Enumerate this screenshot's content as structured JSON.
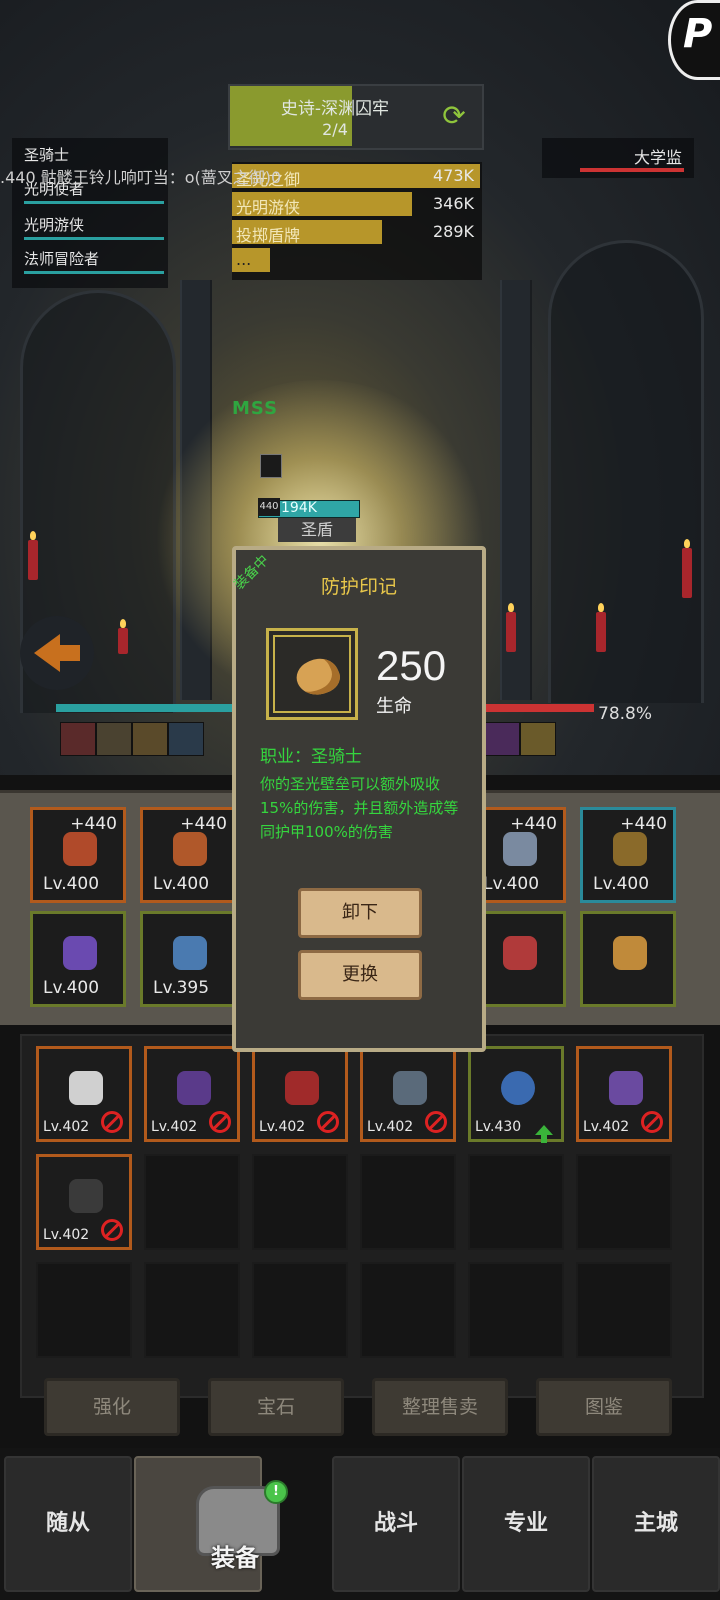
{
  "stage": {
    "title": "史诗-深渊囚牢",
    "progress": "2/4",
    "fill_fraction": 0.5
  },
  "party": [
    "圣骑士",
    "光明使者",
    "光明游侠",
    "法师冒险者"
  ],
  "chat": ".440 骷髅王铃儿响叮当：o(蔷叉之御)0",
  "damage": [
    {
      "name": "圣光之御",
      "value": "473K",
      "fraction": 1.0
    },
    {
      "name": "光明游侠",
      "value": "346K",
      "fraction": 0.73
    },
    {
      "name": "投掷盾牌",
      "value": "289K",
      "fraction": 0.61
    },
    {
      "name": "...",
      "value": "",
      "fraction": 0.16
    }
  ],
  "enemy": {
    "name": "大学监"
  },
  "battle": {
    "miss": "MSS",
    "level_tag": "440",
    "hp_label": "194K",
    "skill_label": "圣盾",
    "enemy_hp_pct": "78.8%"
  },
  "equipped": [
    {
      "plus": "+440",
      "level": "Lv.400",
      "rarity": "orange",
      "icon_color": "#b04a2a"
    },
    {
      "plus": "+440",
      "level": "Lv.400",
      "rarity": "orange",
      "icon_color": "#b0582a"
    },
    {
      "plus": "+440",
      "level": "Lv.400",
      "rarity": "orange",
      "icon_color": "#7a8aa0"
    },
    {
      "plus": "+440",
      "level": "Lv.400",
      "rarity": "blue",
      "icon_color": "#8a6a2a"
    },
    {
      "plus": "",
      "level": "Lv.400",
      "rarity": "green",
      "icon_color": "#6a4ab0"
    },
    {
      "plus": "",
      "level": "Lv.395",
      "rarity": "green",
      "icon_color": "#4a7ab0"
    },
    {
      "plus": "",
      "level": "",
      "rarity": "green",
      "icon_color": "#b03a3a"
    },
    {
      "plus": "",
      "level": "",
      "rarity": "green",
      "icon_color": "#c08a3a"
    }
  ],
  "bag": [
    {
      "level": "Lv.402",
      "rarity": "orange",
      "status": "blocked",
      "icon_color": "#d0d0d0"
    },
    {
      "level": "Lv.402",
      "rarity": "orange",
      "status": "blocked",
      "icon_color": "#5a3a8a"
    },
    {
      "level": "Lv.402",
      "rarity": "orange",
      "status": "blocked",
      "icon_color": "#a02a2a"
    },
    {
      "level": "Lv.402",
      "rarity": "orange",
      "status": "blocked",
      "icon_color": "#5a6a7a"
    },
    {
      "level": "Lv.430",
      "rarity": "green",
      "status": "upgrade",
      "icon_color": "#3a6ab0"
    },
    {
      "level": "Lv.402",
      "rarity": "orange",
      "status": "blocked",
      "icon_color": "#6a4aa0"
    },
    {
      "level": "Lv.402",
      "rarity": "orange",
      "status": "blocked",
      "icon_color": "#3a3a3a"
    }
  ],
  "actions": [
    "强化",
    "宝石",
    "整理售卖",
    "图鉴"
  ],
  "nav": [
    "随从",
    "装备",
    "战斗",
    "专业",
    "主城"
  ],
  "nav_badge": "!",
  "popup": {
    "ribbon": "装备中",
    "title": "防护印记",
    "stat_value": "250",
    "stat_name": "生命",
    "class_line": "职业：圣骑士",
    "description": "你的圣光壁垒可以额外吸收15%的伤害，并且额外造成等同护甲100%的伤害",
    "unequip": "卸下",
    "replace": "更换"
  },
  "colors": {
    "popup_text_green": "#35d63e",
    "popup_title": "#e8c74a",
    "damage_bar": "#b7962a"
  }
}
